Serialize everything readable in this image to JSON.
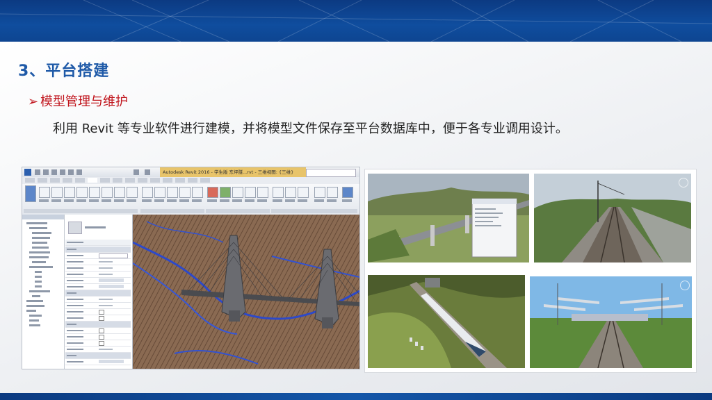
{
  "slide": {
    "heading": "3、平台搭建",
    "bullet": "模型管理与维护",
    "body": "利用 Revit 等专业软件进行建模，并将模型文件保存至平台数据库中，便于各专业调用设计。"
  },
  "revit_window": {
    "title": "Autodesk Revit 2016 - 学生版    东坪隧...rvt - 三维视图: {三维}"
  },
  "colors": {
    "heading": "#1f5aa8",
    "bullet": "#c0141c",
    "topbar": "#0f4d9e"
  },
  "icons": [
    "bullet-arrow-icon"
  ]
}
